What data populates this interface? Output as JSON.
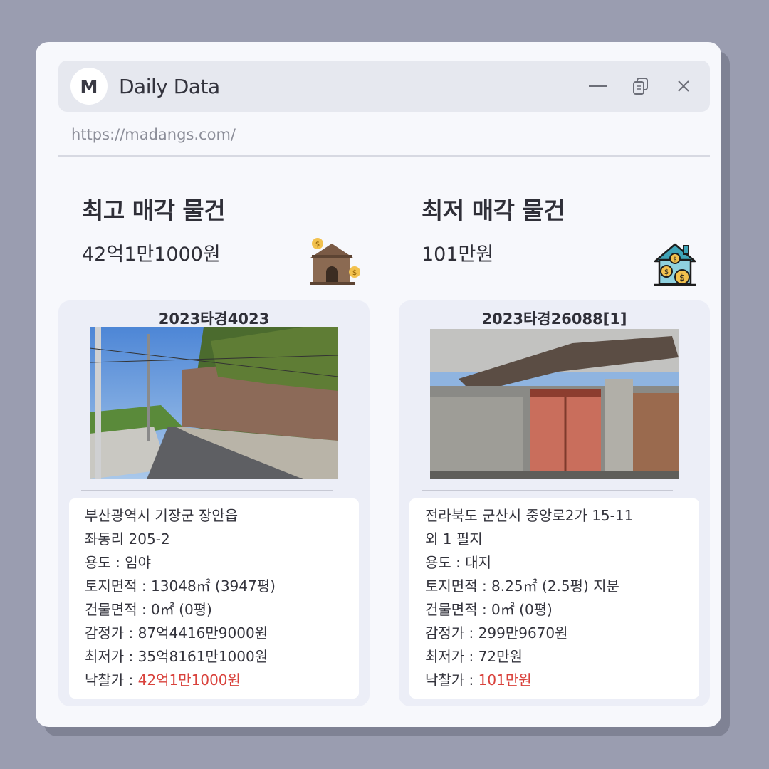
{
  "window": {
    "logo_letter": "M",
    "title": "Daily Data",
    "url": "https://madangs.com/"
  },
  "highest": {
    "heading": "최고 매각 물건",
    "price": "42억1만1000원",
    "case_no": "2023타경4023",
    "address1": "부산광역시 기장군 장안읍",
    "address2": "좌동리 205-2",
    "usage": "용도 : 임야",
    "land_area": "토지면적 : 13048㎡ (3947평)",
    "building_area": "건물면적 : 0㎡ (0평)",
    "appraisal": "감정가 : 87억4416만9000원",
    "minimum": "최저가 : 35억8161만1000원",
    "winning_label": "낙찰가 : ",
    "winning_value": "42억1만1000원"
  },
  "lowest": {
    "heading": "최저 매각 물건",
    "price": "101만원",
    "case_no": "2023타경26088[1]",
    "address1": "전라북도 군산시 중앙로2가 15-11",
    "address2": "외 1 필지",
    "usage": "용도 : 대지",
    "land_area": "토지면적 :  8.25㎡ (2.5평) 지분",
    "building_area": "건물면적 : 0㎡ (0평)",
    "appraisal": "감정가 : 299만9670원",
    "minimum": "최저가 : 72만원",
    "winning_label": "낙찰가 : ",
    "winning_value": "101만원"
  },
  "icons": [
    "minimize-icon",
    "restore-icon",
    "close-icon",
    "house-money-icon",
    "home-coins-icon"
  ],
  "colors": {
    "accent_red": "#d9423c",
    "background": "#9a9db0",
    "panel": "#f7f8fc"
  }
}
